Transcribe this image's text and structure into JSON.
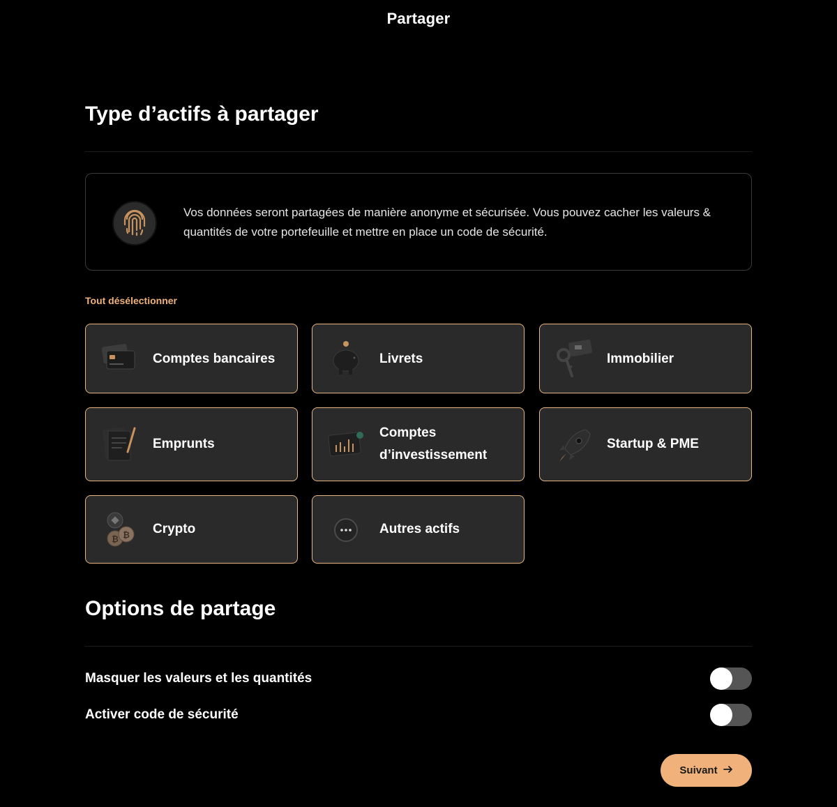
{
  "header": {
    "title": "Partager"
  },
  "asset_section": {
    "title": "Type d’actifs à partager",
    "info_text": "Vos données seront partagées de manière anonyme et sécurisée. Vous pouvez cacher les valeurs & quantités de votre portefeuille et mettre en place un code de sécurité.",
    "info_icon": "fingerprint-icon",
    "deselect_all_label": "Tout désélectionner",
    "assets": [
      {
        "label": "Comptes bancaires",
        "icon": "bank-cards-icon",
        "selected": true
      },
      {
        "label": "Livrets",
        "icon": "piggy-bank-icon",
        "selected": true
      },
      {
        "label": "Immobilier",
        "icon": "house-keys-icon",
        "selected": true
      },
      {
        "label": "Emprunts",
        "icon": "documents-pen-icon",
        "selected": true
      },
      {
        "label": "Comptes d’investissement",
        "icon": "investment-chart-icon",
        "selected": true
      },
      {
        "label": "Startup & PME",
        "icon": "rocket-icon",
        "selected": true
      },
      {
        "label": "Crypto",
        "icon": "crypto-coins-icon",
        "selected": true
      },
      {
        "label": "Autres actifs",
        "icon": "more-dots-icon",
        "selected": true
      }
    ]
  },
  "options_section": {
    "title": "Options de partage",
    "options": [
      {
        "label": "Masquer les valeurs et les quantités",
        "enabled": false
      },
      {
        "label": "Activer code de sécurité",
        "enabled": false
      }
    ]
  },
  "footer": {
    "next_label": "Suivant",
    "next_icon": "arrow-right-icon"
  },
  "colors": {
    "background": "#000000",
    "card_background": "#2a2a2a",
    "accent": "#f0b27a",
    "card_border_selected": "#e8b884",
    "toggle_off": "#555555"
  }
}
